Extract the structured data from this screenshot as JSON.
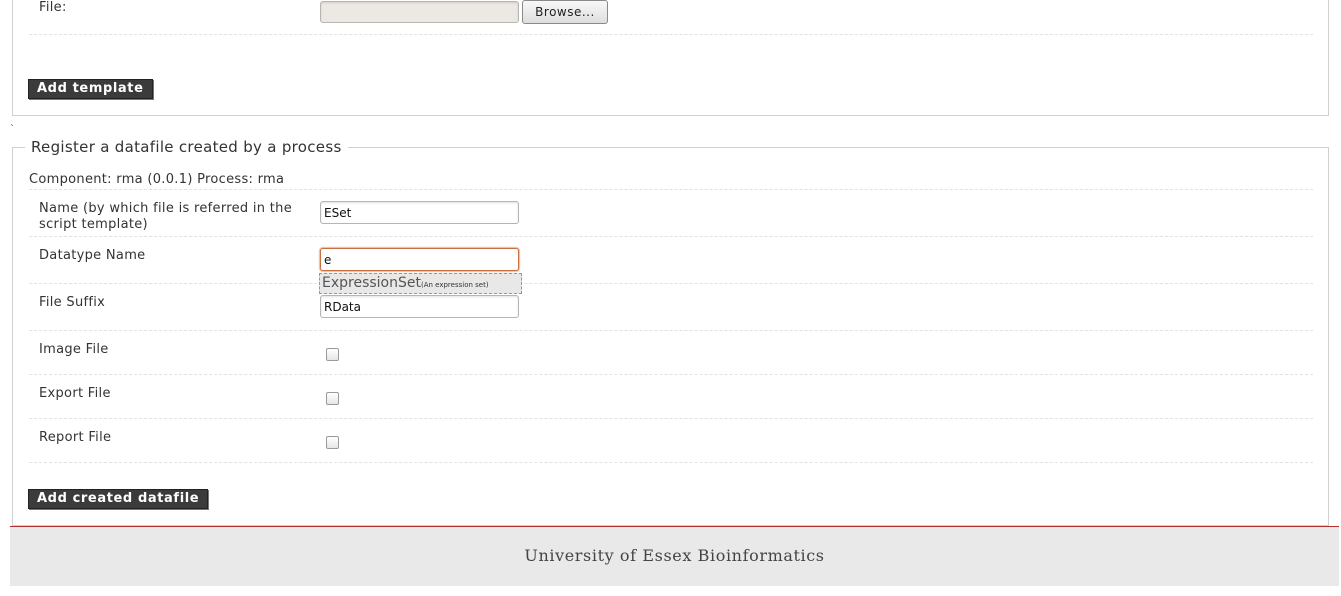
{
  "template_section": {
    "file_label": "File:",
    "file_value": "",
    "browse_label": "Browse...",
    "add_button": "Add template"
  },
  "stray_mark": "`",
  "datafile_section": {
    "legend": "Register a datafile created by a process",
    "info": "Component: rma (0.0.1) Process: rma",
    "name_label": "Name (by which file is referred in the script template)",
    "name_value": "ESet",
    "datatype_label": "Datatype Name",
    "datatype_value": "e",
    "suggestion_name": "ExpressionSet",
    "suggestion_desc": "(An expression set)",
    "suffix_label": "File Suffix",
    "suffix_value": "RData",
    "image_label": "Image File",
    "image_checked": false,
    "export_label": "Export File",
    "export_checked": false,
    "report_label": "Report File",
    "report_checked": false,
    "add_button": "Add created datafile"
  },
  "footer": {
    "text": "University of Essex Bioinformatics"
  }
}
